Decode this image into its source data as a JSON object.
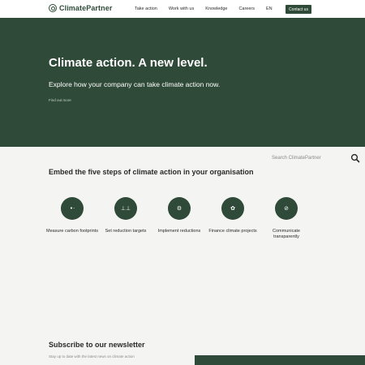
{
  "brand": {
    "name": "ClimatePartner"
  },
  "nav": {
    "items": [
      "Take action",
      "Work with us",
      "Knowledge",
      "Careers"
    ],
    "language": "EN",
    "contact_label": "Contact us"
  },
  "hero": {
    "title": "Climate action. A new level.",
    "subtitle": "Explore how your company can take climate action now.",
    "link": "Find out more"
  },
  "search": {
    "placeholder": "Search ClimatePartner"
  },
  "steps_section": {
    "title": "Embed the five steps of climate action in your organisation",
    "steps": [
      {
        "label": "Measure carbon footprints",
        "icon": "footprint-icon"
      },
      {
        "label": "Set reduction targets",
        "icon": "target-icon"
      },
      {
        "label": "Implement reductions",
        "icon": "reduction-icon"
      },
      {
        "label": "Finance climate projects",
        "icon": "finance-icon"
      },
      {
        "label": "Communicate transparently",
        "icon": "communicate-icon"
      }
    ]
  },
  "newsletter": {
    "title": "Subscribe to our newsletter",
    "text": "Stay up to date with the latest news on climate action"
  },
  "colors": {
    "brand_green": "#2f4a38",
    "background": "#f4f4f2",
    "header": "#ffffff"
  }
}
